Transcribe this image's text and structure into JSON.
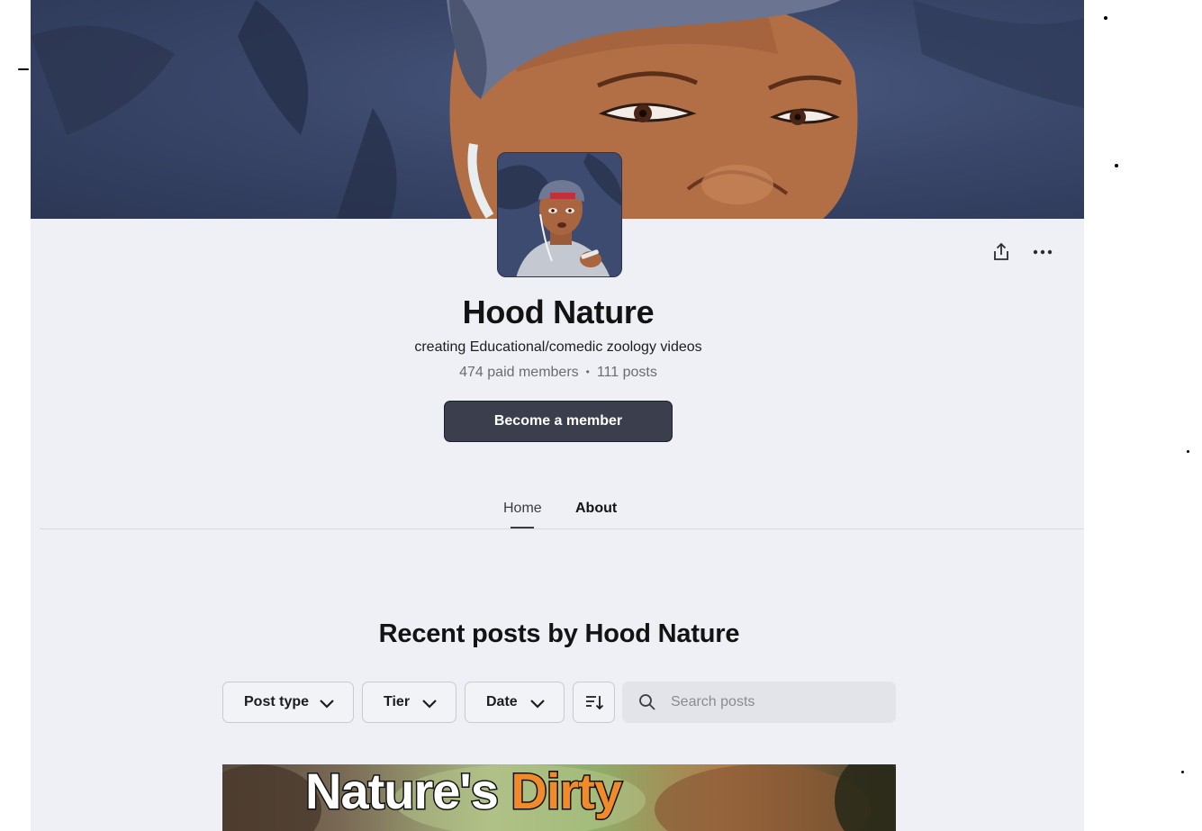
{
  "creator": {
    "name": "Hood Nature",
    "tagline": "creating Educational/comedic zoology videos",
    "paid_members": "474 paid members",
    "separator": "•",
    "posts_count": "111 posts"
  },
  "actions": {
    "become_member": "Become a member",
    "share_icon": "share-icon",
    "more_icon": "more-horizontal-icon"
  },
  "tabs": [
    {
      "label": "Home",
      "active": true
    },
    {
      "label": "About",
      "active": false
    }
  ],
  "recent": {
    "title": "Recent posts by Hood Nature",
    "filters": {
      "post_type": "Post type",
      "tier": "Tier",
      "date": "Date"
    },
    "search_placeholder": "Search posts"
  },
  "post_thumbnail": {
    "word1": "Nature's",
    "word2": "Dirty"
  },
  "colors": {
    "page_bg": "#eff0f5",
    "button_bg": "#3b3e4c",
    "accent_orange": "#f08a2a"
  }
}
